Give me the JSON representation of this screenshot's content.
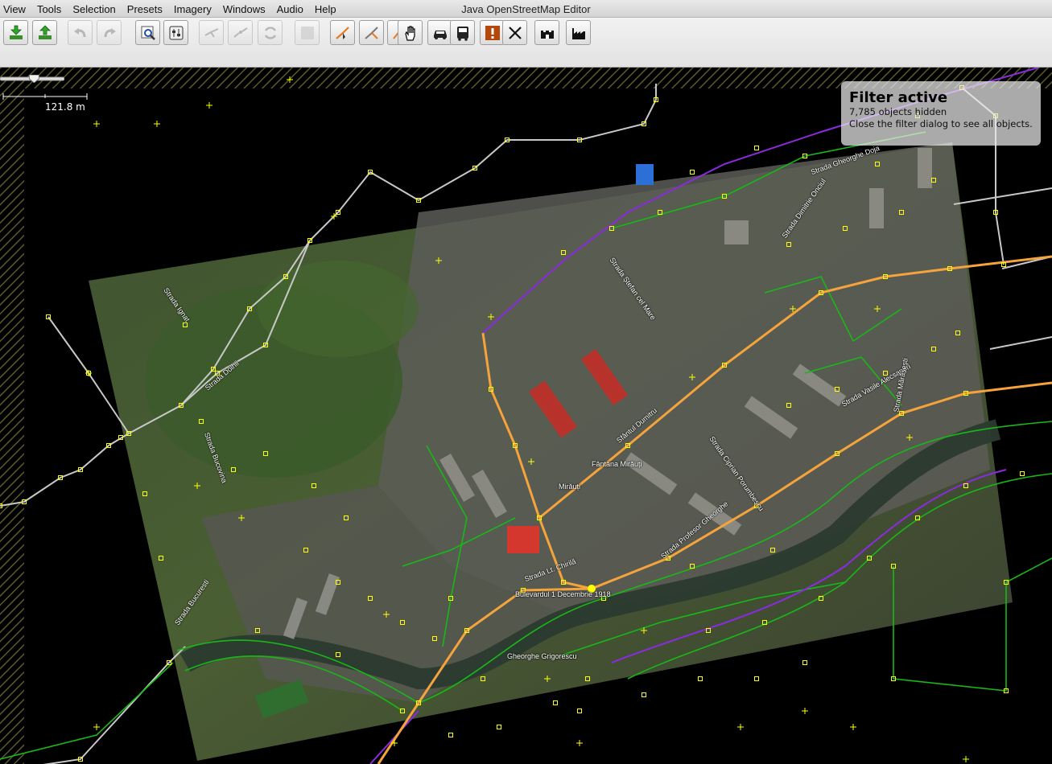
{
  "window": {
    "title": "Java OpenStreetMap Editor"
  },
  "menu": {
    "items": [
      {
        "name": "menu-view",
        "label": "View"
      },
      {
        "name": "menu-tools",
        "label": "Tools"
      },
      {
        "name": "menu-selection",
        "label": "Selection"
      },
      {
        "name": "menu-presets",
        "label": "Presets"
      },
      {
        "name": "menu-imagery",
        "label": "Imagery"
      },
      {
        "name": "menu-windows",
        "label": "Windows"
      },
      {
        "name": "menu-audio",
        "label": "Audio"
      },
      {
        "name": "menu-help",
        "label": "Help"
      }
    ]
  },
  "toolbar": {
    "buttons": [
      {
        "name": "download-button",
        "icon": "download-icon",
        "enabled": true
      },
      {
        "name": "upload-button",
        "icon": "upload-icon",
        "enabled": true
      },
      {
        "name": "undo-button",
        "icon": "undo-icon",
        "enabled": false
      },
      {
        "name": "redo-button",
        "icon": "redo-icon",
        "enabled": false
      },
      {
        "name": "zoom-to-selection-button",
        "icon": "magnifier-icon",
        "enabled": true
      },
      {
        "name": "preferences-button",
        "icon": "preferences-icon",
        "enabled": true
      },
      {
        "name": "combine-way-button",
        "icon": "combine-way-icon",
        "enabled": false
      },
      {
        "name": "split-way-button",
        "icon": "split-way-icon",
        "enabled": false
      },
      {
        "name": "reverse-way-button",
        "icon": "reverse-way-icon",
        "enabled": false
      },
      {
        "name": "paste-button",
        "icon": "paste-icon",
        "enabled": false
      },
      {
        "name": "select-mode-button",
        "icon": "select-icon",
        "enabled": true
      },
      {
        "name": "draw-mode-button",
        "icon": "draw-icon",
        "enabled": true
      },
      {
        "name": "improve-way-button",
        "icon": "improve-way-icon",
        "enabled": true
      },
      {
        "name": "pan-mode-button",
        "icon": "hand-icon",
        "enabled": true
      },
      {
        "name": "car-preset-button",
        "icon": "car-icon",
        "enabled": true
      },
      {
        "name": "bus-preset-button",
        "icon": "bus-icon",
        "enabled": true
      },
      {
        "name": "validator-button",
        "icon": "warning-icon",
        "enabled": true
      },
      {
        "name": "delete-button",
        "icon": "cross-icon",
        "enabled": true
      },
      {
        "name": "castle-preset-button",
        "icon": "castle-icon",
        "enabled": true
      },
      {
        "name": "industrial-preset-button",
        "icon": "factory-icon",
        "enabled": true
      }
    ]
  },
  "map": {
    "scale_label": "121.8 m",
    "zoom_level_fraction": 0.53
  },
  "filter": {
    "title": "Filter active",
    "hidden_count": "7,785",
    "hidden_suffix": "objects hidden",
    "hint": "Close the filter dialog to see all objects."
  },
  "street_labels": [
    "Strada Dolhii",
    "Strada Ignat",
    "Strada Bucovina",
    "Strada Bucuresti",
    "Strada Ștefan cel Mare",
    "Strada Profesor Gheorghe",
    "Strada Ciprian Porumbescu",
    "Fântâna Mirăuți",
    "Mirăuți",
    "Strada Profesor G. Scortea",
    "Sfântul Dumitru",
    "Strada Vasile Alecsandri",
    "Strada Mărășești",
    "Strada Dimitrie Onciul",
    "Strada Gheorghe Doja",
    "Bulevardul 1 Decembrie 1918",
    "Strada 1 Decembrie 1918",
    "Gheorghe Grigorescu",
    "Strada Lt. Chirilă",
    "Piața",
    "Tinerețului"
  ],
  "colors": {
    "accent_primary": "#f5a33c",
    "node_color": "#ffff00",
    "footway": "#18b818",
    "railway": "#8a2be2",
    "generic_way": "#c8c8c8",
    "panel_bg": "#ebebeb"
  }
}
